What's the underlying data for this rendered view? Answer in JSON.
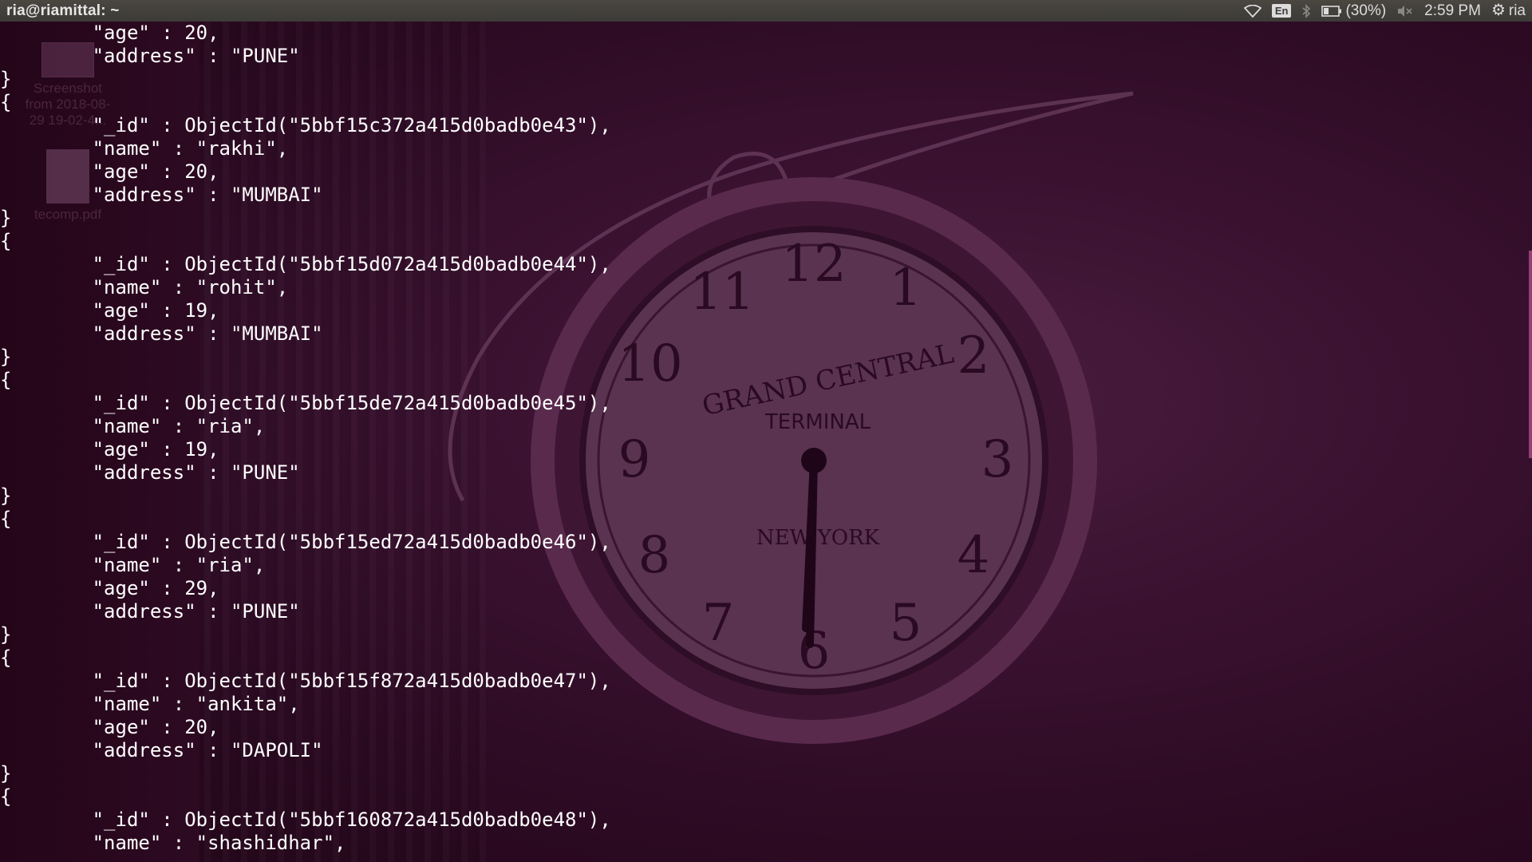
{
  "topbar": {
    "title": "ria@riamittal: ~",
    "lang": "En",
    "battery": "(30%)",
    "time": "2:59 PM",
    "user": "ria"
  },
  "desktop": {
    "icons": [
      {
        "label_lines": [
          "Screenshot",
          "from 2018-08-",
          "29 19-02-4..."
        ]
      },
      {
        "label_lines": [
          "tecomp.pdf"
        ]
      }
    ],
    "clock": {
      "numerals": [
        "12",
        "1",
        "2",
        "3",
        "4",
        "5",
        "6",
        "7",
        "8",
        "9",
        "10",
        "11"
      ],
      "brand": "GRAND CENTRAL",
      "sub": "TERMINAL",
      "city": "NEW YORK"
    }
  },
  "terminal": {
    "lines": [
      "        \"age\" : 20,",
      "        \"address\" : \"PUNE\"",
      "}",
      "{",
      "        \"_id\" : ObjectId(\"5bbf15c372a415d0badb0e43\"),",
      "        \"name\" : \"rakhi\",",
      "        \"age\" : 20,",
      "        \"address\" : \"MUMBAI\"",
      "}",
      "{",
      "        \"_id\" : ObjectId(\"5bbf15d072a415d0badb0e44\"),",
      "        \"name\" : \"rohit\",",
      "        \"age\" : 19,",
      "        \"address\" : \"MUMBAI\"",
      "}",
      "{",
      "        \"_id\" : ObjectId(\"5bbf15de72a415d0badb0e45\"),",
      "        \"name\" : \"ria\",",
      "        \"age\" : 19,",
      "        \"address\" : \"PUNE\"",
      "}",
      "{",
      "        \"_id\" : ObjectId(\"5bbf15ed72a415d0badb0e46\"),",
      "        \"name\" : \"ria\",",
      "        \"age\" : 29,",
      "        \"address\" : \"PUNE\"",
      "}",
      "{",
      "        \"_id\" : ObjectId(\"5bbf15f872a415d0badb0e47\"),",
      "        \"name\" : \"ankita\",",
      "        \"age\" : 20,",
      "        \"address\" : \"DAPOLI\"",
      "}",
      "{",
      "        \"_id\" : ObjectId(\"5bbf160872a415d0badb0e48\"),",
      "        \"name\" : \"shashidhar\","
    ]
  },
  "colors": {
    "terminal_bg": "#2a0b20",
    "panel_bg": "#3c3b37",
    "text": "#ffffff"
  }
}
